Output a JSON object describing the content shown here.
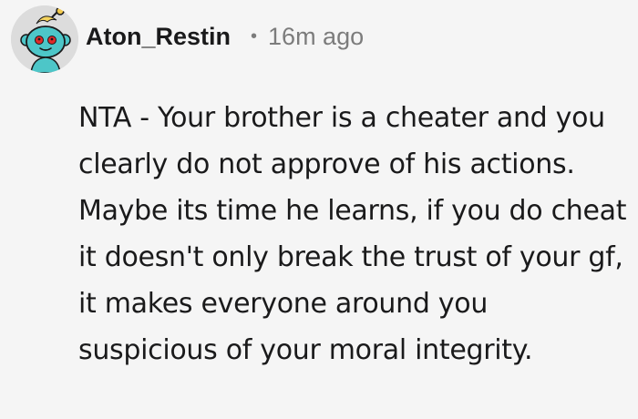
{
  "comment": {
    "author": "Aton_Restin",
    "separator": "•",
    "timestamp": "16m ago",
    "avatar_icon": "snoo-avatar-icon",
    "body": "NTA - Your brother is a cheater and you clearly do not approve of his actions. Maybe its time he learns, if you do cheat it doesn't only break the trust of your gf, it makes everyone around you suspicious of your moral integrity."
  },
  "colors": {
    "background": "#f5f5f5",
    "text": "#1a1a1b",
    "meta_text": "#7c7c7c",
    "avatar_teal": "#4dc6c8",
    "avatar_eye_red": "#e02b2b"
  }
}
